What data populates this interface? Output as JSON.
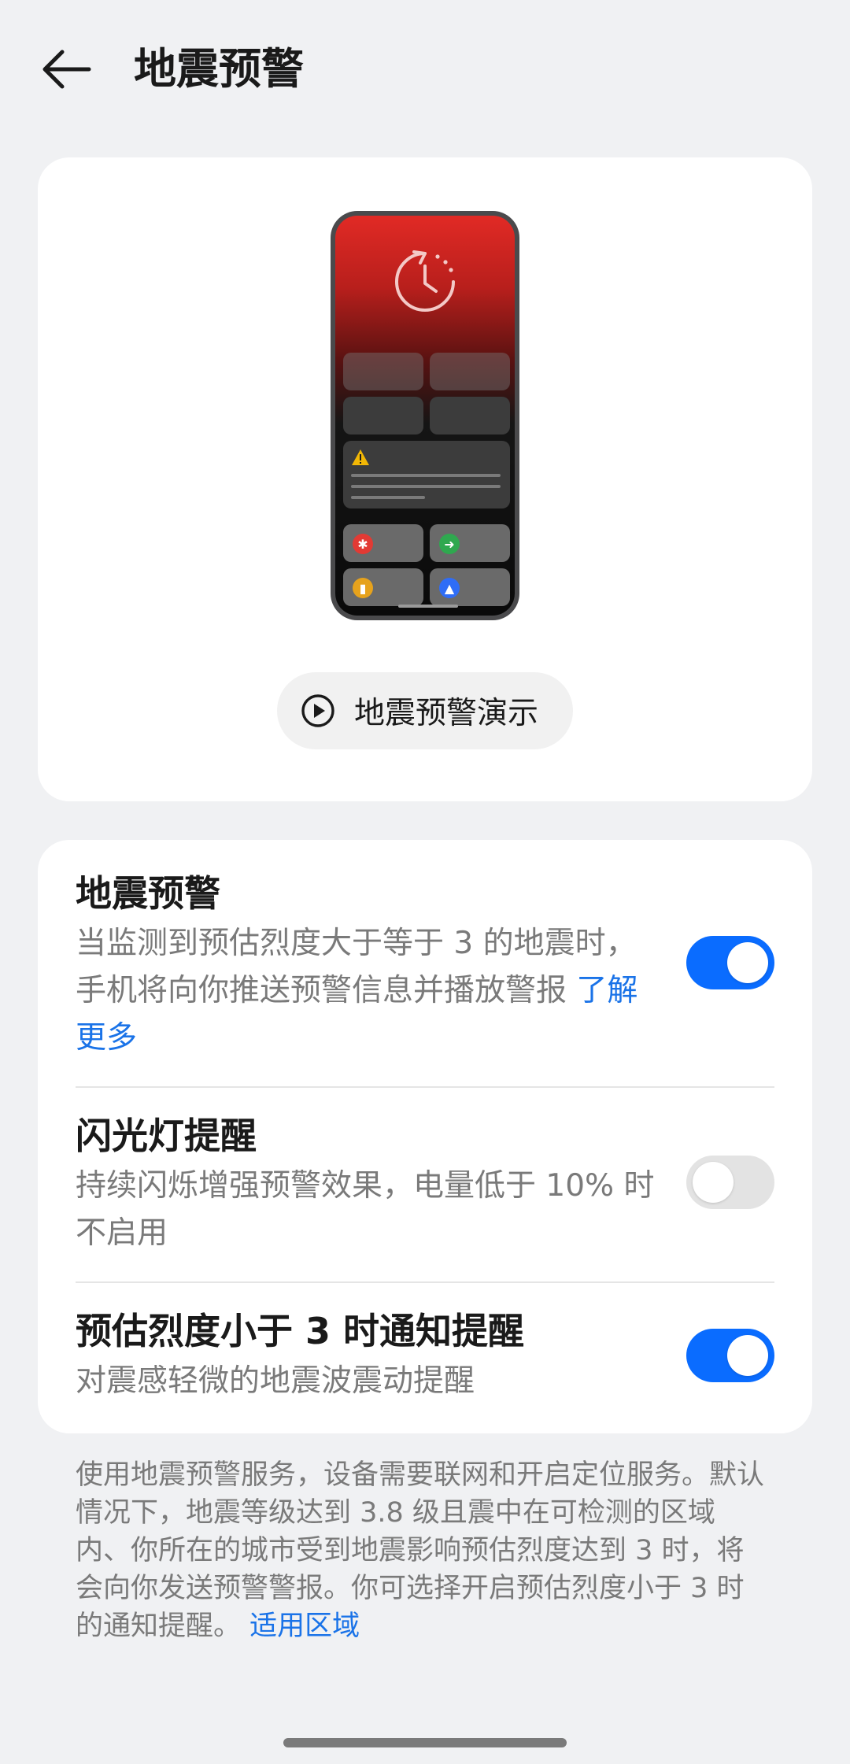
{
  "header": {
    "title": "地震预警",
    "back_icon": "arrow-left-icon"
  },
  "illustration": {
    "phone_icons": [
      "time-refresh-icon",
      "warning-triangle-icon",
      "medical-icon",
      "running-person-icon",
      "flashlight-icon",
      "siren-icon"
    ],
    "colors": {
      "alert_red": "#e12a25",
      "green": "#2fa84f",
      "yellow": "#e6a21c",
      "blue": "#2f6df6"
    }
  },
  "demo_button": {
    "label": "地震预警演示",
    "icon": "play-circle-icon"
  },
  "settings": {
    "earthquake_alert": {
      "title": "地震预警",
      "desc": "当监测到预估烈度大于等于 3 的地震时，手机将向你推送预警信息并播放警报 ",
      "link": "了解更多",
      "enabled": true
    },
    "flash_alert": {
      "title": "闪光灯提醒",
      "desc": "持续闪烁增强预警效果，电量低于 10% 时不启用",
      "enabled": false
    },
    "low_intensity_notify": {
      "title": "预估烈度小于 3 时通知提醒",
      "desc": "对震感轻微的地震波震动提醒",
      "enabled": true
    }
  },
  "footnote": {
    "text": "使用地震预警服务，设备需要联网和开启定位服务。默认情况下，地震等级达到 3.8 级且震中在可检测的区域内、你所在的城市受到地震影响预估烈度达到 3 时，将会向你发送预警警报。你可选择开启预估烈度小于 3 时的通知提醒。 ",
    "link": "适用区域"
  },
  "colors": {
    "accent": "#0a6cff",
    "link": "#1a73e8",
    "background": "#f0f1f3"
  }
}
